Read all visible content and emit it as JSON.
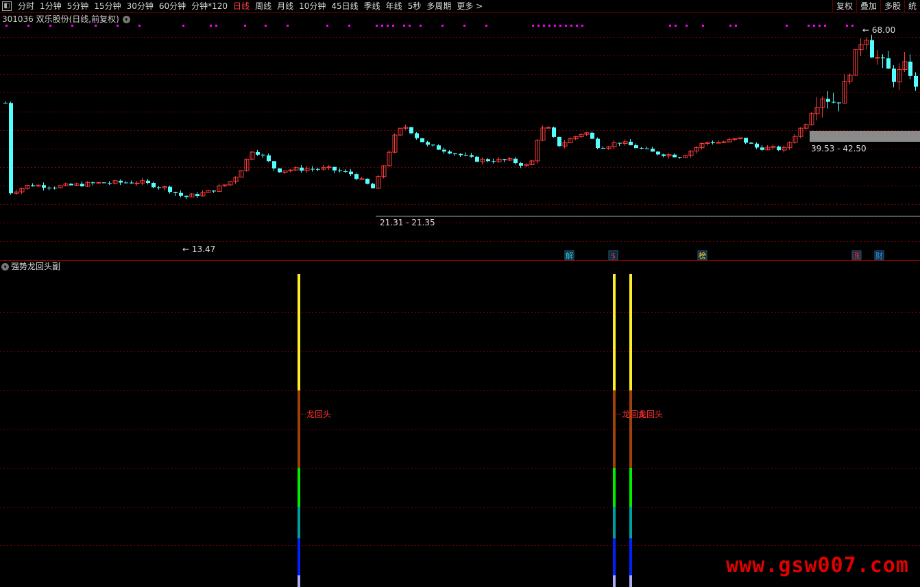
{
  "toolbar": {
    "periods": [
      "分时",
      "1分钟",
      "5分钟",
      "15分钟",
      "30分钟",
      "60分钟",
      "分钟*120",
      "日线",
      "周线",
      "月线",
      "10分钟",
      "45日线",
      "季线",
      "年线",
      "5秒",
      "多周期",
      "更多 >"
    ],
    "active_period": "日线",
    "right_buttons": [
      "复权",
      "叠加",
      "多股",
      "统"
    ]
  },
  "main_chart": {
    "title": "301036 双乐股份(日线,前复权)",
    "high_label": "68.00",
    "low_label": "13.47",
    "zone_label_1": "21.31 - 21.35",
    "zone_label_2": "39.53 - 42.50",
    "event_tags": [
      {
        "text": "解",
        "color": "#33ccdd"
      },
      {
        "text": "$",
        "color": "#ff3030"
      },
      {
        "text": "榜",
        "color": "#ffcc33"
      },
      {
        "text": "涨",
        "color": "#ff3030"
      },
      {
        "text": "财",
        "color": "#3399ff"
      }
    ]
  },
  "sub_chart": {
    "title": "强势龙回头副",
    "signals": [
      {
        "label": "龙回头"
      },
      {
        "label": "龙回头"
      },
      {
        "label": "龙回头"
      }
    ]
  },
  "watermark": "www.gsw007.com",
  "colors": {
    "up": "#ff3c3c",
    "down": "#54ffff",
    "grid": "#7a0000",
    "dots": "#ff00ff"
  }
}
